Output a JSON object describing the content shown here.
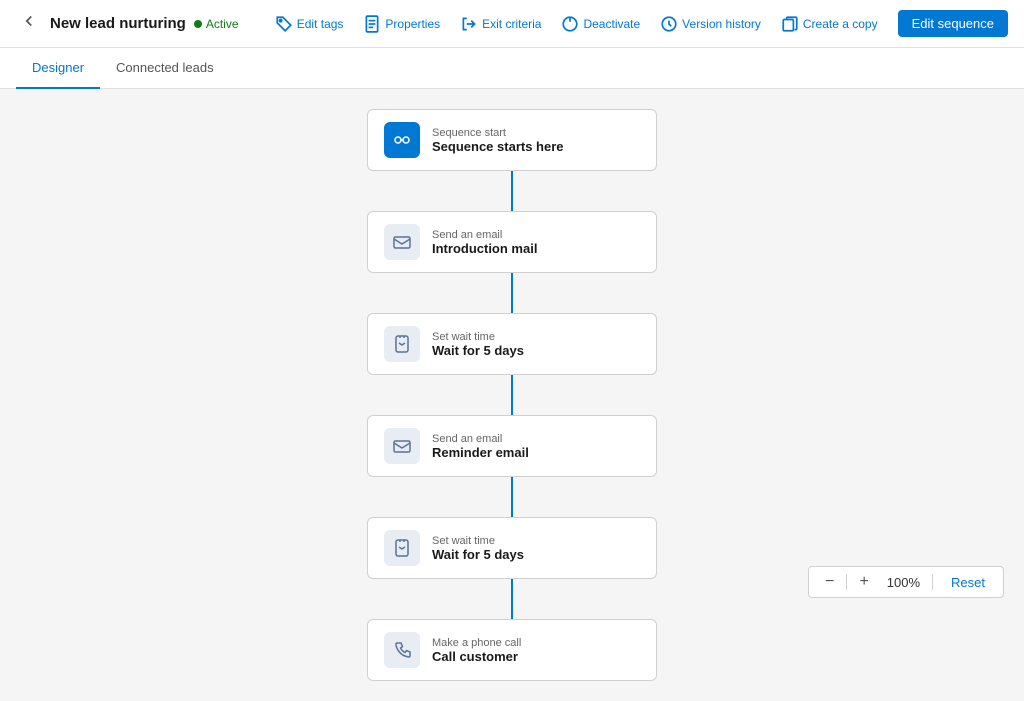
{
  "header": {
    "title": "New lead nurturing",
    "status": "Active",
    "back_label": "←",
    "actions": [
      {
        "id": "edit-tags",
        "label": "Edit tags",
        "icon": "tag"
      },
      {
        "id": "properties",
        "label": "Properties",
        "icon": "document"
      },
      {
        "id": "exit-criteria",
        "label": "Exit criteria",
        "icon": "exit"
      },
      {
        "id": "deactivate",
        "label": "Deactivate",
        "icon": "power"
      },
      {
        "id": "version-history",
        "label": "Version history",
        "icon": "history"
      },
      {
        "id": "create-copy",
        "label": "Create a copy",
        "icon": "copy"
      }
    ],
    "edit_button": "Edit sequence"
  },
  "tabs": [
    {
      "id": "designer",
      "label": "Designer",
      "active": true
    },
    {
      "id": "connected-leads",
      "label": "Connected leads",
      "active": false
    }
  ],
  "sequence_nodes": [
    {
      "id": "start",
      "type": "start",
      "icon_type": "blue",
      "icon": "⚙",
      "label": "Sequence start",
      "title": "Sequence starts here"
    },
    {
      "id": "email-1",
      "type": "email",
      "icon_type": "gray",
      "icon": "✉",
      "label": "Send an email",
      "title": "Introduction mail"
    },
    {
      "id": "wait-1",
      "type": "wait",
      "icon_type": "gray",
      "icon": "⏱",
      "label": "Set wait time",
      "title": "Wait for 5 days"
    },
    {
      "id": "email-2",
      "type": "email",
      "icon_type": "gray",
      "icon": "✉",
      "label": "Send an email",
      "title": "Reminder email"
    },
    {
      "id": "wait-2",
      "type": "wait",
      "icon_type": "gray",
      "icon": "⏱",
      "label": "Set wait time",
      "title": "Wait for 5 days"
    },
    {
      "id": "phone-1",
      "type": "phone",
      "icon_type": "gray",
      "icon": "📞",
      "label": "Make a phone call",
      "title": "Call customer"
    }
  ],
  "zoom": {
    "minus": "−",
    "plus": "+",
    "value": "100%",
    "reset": "Reset"
  }
}
